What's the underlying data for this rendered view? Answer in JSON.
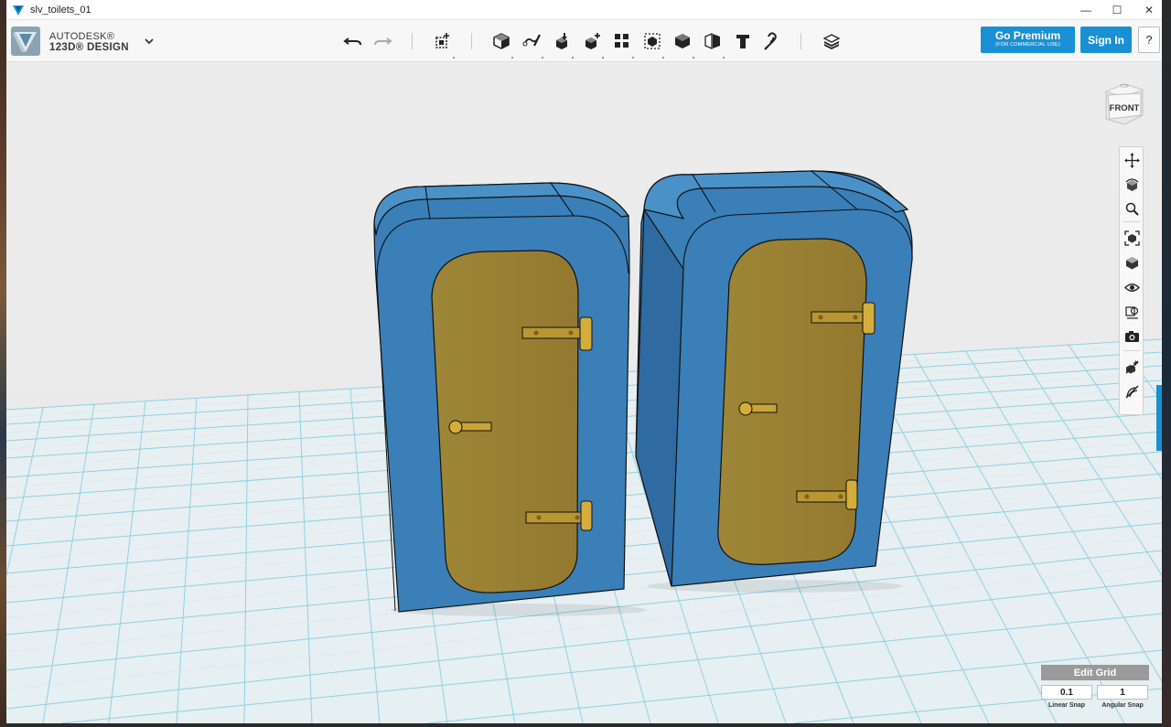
{
  "window": {
    "title": "slv_toilets_01",
    "controls": {
      "minimize": "—",
      "maximize": "☐",
      "close": "✕"
    }
  },
  "brand": {
    "line1": "AUTODESK®",
    "line2": "123D® DESIGN",
    "accent_color": "#1a90d4"
  },
  "toolbar": {
    "tools": [
      "undo-icon",
      "redo-icon",
      "transform-icon",
      "primitives-icon",
      "sketch-icon",
      "construct-icon",
      "modify-icon",
      "pattern-icon",
      "grouping-icon",
      "combine-icon",
      "measure-icon",
      "text-icon",
      "snap-icon",
      "material-icon"
    ],
    "premium_label": "Go Premium",
    "premium_sub": "(FOR COMMERCIAL USE)",
    "signin_label": "Sign In",
    "help_label": "?"
  },
  "viewcube": {
    "face_label": "FRONT",
    "top_label": "TOP"
  },
  "navbar": {
    "items": [
      "pan-icon",
      "orbit-icon",
      "zoom-icon",
      "fit-icon",
      "view-mode-icon",
      "visibility-icon",
      "material-view-icon",
      "screenshot-icon",
      "hide-sketch-icon",
      "hide-mesh-icon"
    ]
  },
  "grid": {
    "edit_label": "Edit Grid",
    "linear_value": "0.1",
    "angular_value": "1",
    "linear_label": "Linear Snap",
    "angular_label": "Angular Snap"
  },
  "scene": {
    "model_color": "#3a7fb8",
    "door_color": "#9a8235",
    "hinge_color": "#d4ad3a",
    "grid_line_color": "#8fcfe0"
  }
}
